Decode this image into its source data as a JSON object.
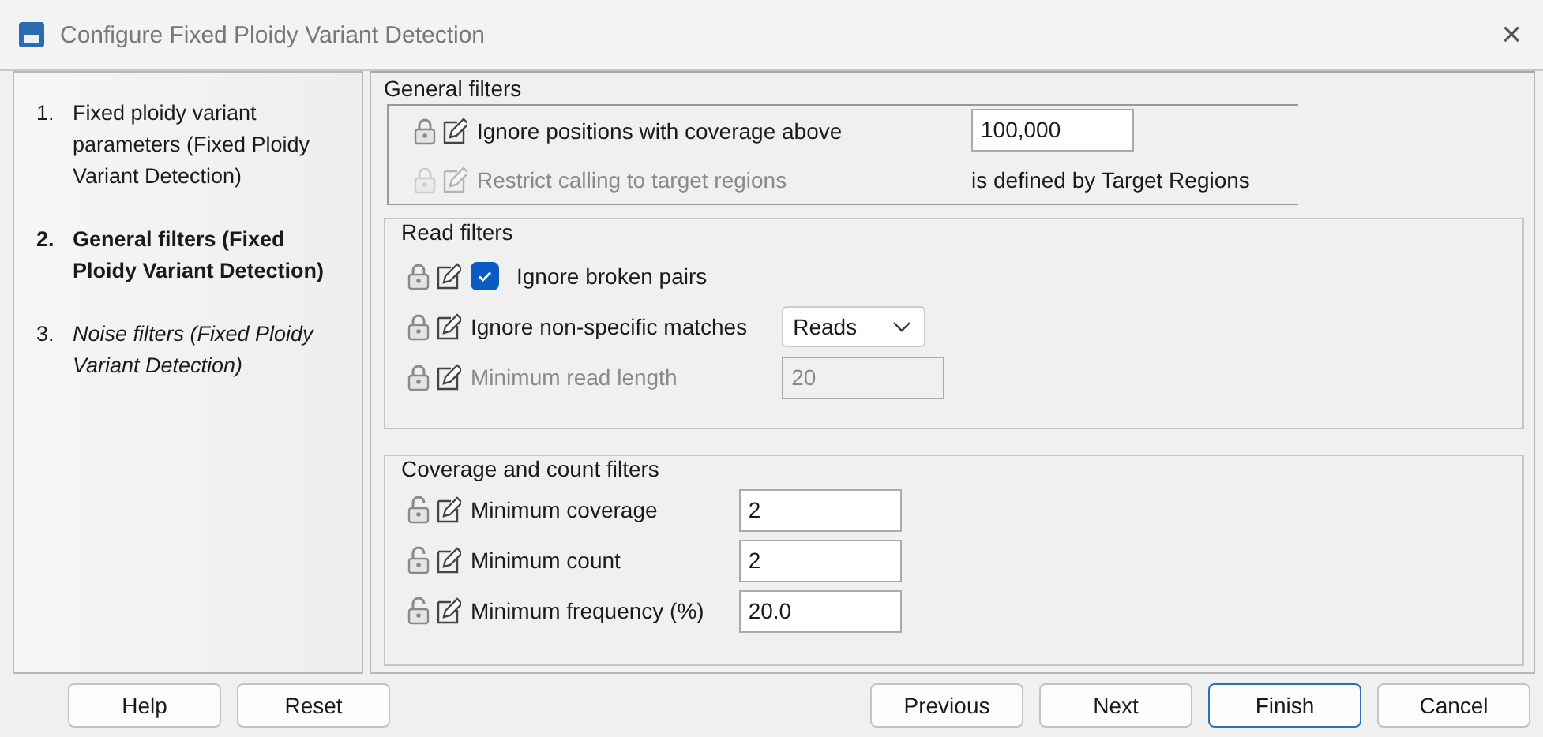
{
  "window": {
    "title": "Configure Fixed Ploidy Variant Detection",
    "close": "×"
  },
  "steps": [
    {
      "number": "1.",
      "label": "Fixed ploidy variant parameters (Fixed Ploidy Variant Detection)",
      "selected": false,
      "visited": true
    },
    {
      "number": "2.",
      "label": "General filters (Fixed Ploidy Variant Detection)",
      "selected": true,
      "visited": true
    },
    {
      "number": "3.",
      "label": "Noise filters (Fixed Ploidy Variant Detection)",
      "selected": false,
      "visited": false
    }
  ],
  "sections": [
    {
      "title": "General filters",
      "kind": "bracket",
      "rows": [
        {
          "kind": "field",
          "label": "Ignore positions with coverage above",
          "value": "100,000",
          "locked": true,
          "disabled": false
        },
        {
          "kind": "info",
          "label": "Restrict calling to target regions",
          "value": "is defined by Target Regions",
          "locked": true,
          "disabled": true
        }
      ]
    },
    {
      "title": "Read filters",
      "kind": "frame",
      "rows": [
        {
          "kind": "checkbox",
          "label": "Ignore broken pairs",
          "checked": true,
          "locked": true,
          "disabled": false
        },
        {
          "kind": "dropdown",
          "label": "Ignore non-specific matches",
          "value": "Reads",
          "locked": true,
          "disabled": false
        },
        {
          "kind": "field",
          "label": "Minimum read length",
          "value": "20",
          "locked": true,
          "disabled": true
        }
      ]
    },
    {
      "title": "Coverage and count filters",
      "kind": "frame",
      "rows": [
        {
          "kind": "field",
          "label": "Minimum coverage",
          "value": "2",
          "locked": false,
          "disabled": false
        },
        {
          "kind": "field",
          "label": "Minimum count",
          "value": "2",
          "locked": false,
          "disabled": false
        },
        {
          "kind": "field",
          "label": "Minimum frequency (%)",
          "value": "20.0",
          "locked": false,
          "disabled": false
        }
      ]
    }
  ],
  "buttons_left": [
    {
      "label": "Help",
      "default": false
    },
    {
      "label": "Reset",
      "default": false
    }
  ],
  "buttons_right": [
    {
      "label": "Previous",
      "default": false
    },
    {
      "label": "Next",
      "default": false
    },
    {
      "label": "Finish",
      "default": true
    },
    {
      "label": "Cancel",
      "default": false
    }
  ]
}
